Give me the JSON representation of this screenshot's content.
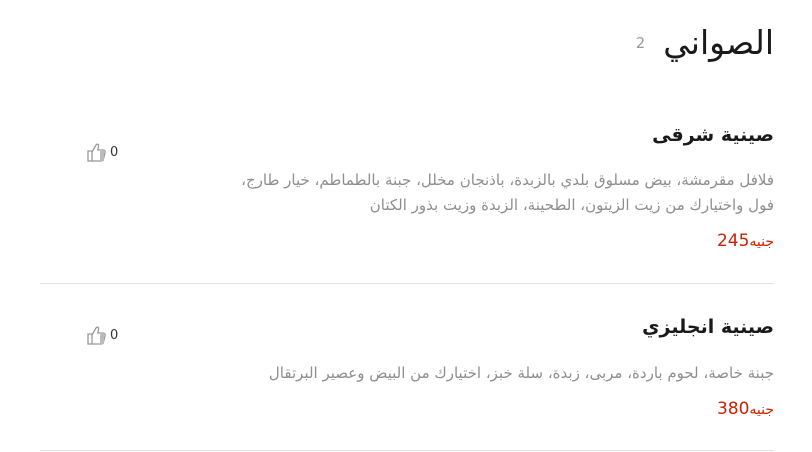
{
  "section": {
    "title": "الصواني",
    "count": "2"
  },
  "items": [
    {
      "name": "صينية شرقى",
      "description": "فلافل مقرمشة، بيض مسلوق بلدي بالزبدة، باذنجان مخلل، جبنة بالطماطم، خيار طارج، فول واختيارك من زيت الزيتون، الطحينة، الزبدة وزيت بذور الكتان",
      "price": "245",
      "currency": "جنيه",
      "likes": "0"
    },
    {
      "name": "صينية انجليزي",
      "description": "جبنة خاصة، لحوم باردة، مربى، زبدة، سلة خبز، اختيارك من البيض وعصير البرتقال",
      "price": "380",
      "currency": "جنيه",
      "likes": "0"
    }
  ],
  "colors": {
    "price": "#cc2200",
    "description": "#8e8e8e",
    "divider": "#e2e2e2"
  },
  "icons": {
    "like": "thumbs-up-icon"
  }
}
